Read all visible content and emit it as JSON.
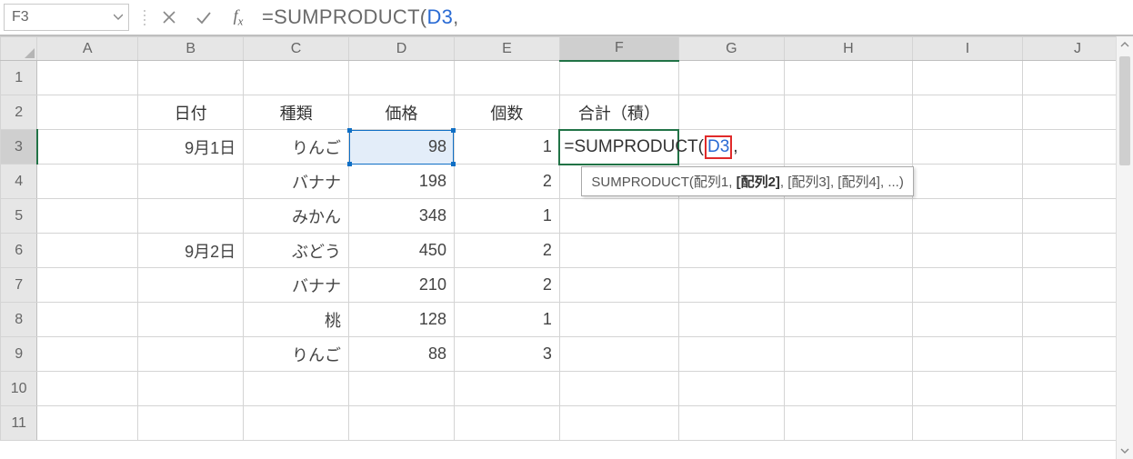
{
  "name_box": {
    "value": "F3"
  },
  "formula_bar": {
    "prefix": "=SUMPRODUCT(",
    "ref": "D3",
    "suffix": ","
  },
  "columns": [
    "A",
    "B",
    "C",
    "D",
    "E",
    "F",
    "G",
    "H",
    "I",
    "J"
  ],
  "rows": [
    "1",
    "2",
    "3",
    "4",
    "5",
    "6",
    "7",
    "8",
    "9",
    "10",
    "11"
  ],
  "table": {
    "headers": {
      "B": "日付",
      "C": "種類",
      "D": "価格",
      "E": "個数",
      "F": "合計（積）"
    },
    "rows": [
      {
        "B": "9月1日",
        "C": "りんご",
        "D": "98",
        "E": "1"
      },
      {
        "B": "",
        "C": "バナナ",
        "D": "198",
        "E": "2"
      },
      {
        "B": "",
        "C": "みかん",
        "D": "348",
        "E": "1"
      },
      {
        "B": "9月2日",
        "C": "ぶどう",
        "D": "450",
        "E": "2"
      },
      {
        "B": "",
        "C": "バナナ",
        "D": "210",
        "E": "2"
      },
      {
        "B": "",
        "C": "桃",
        "D": "128",
        "E": "1"
      },
      {
        "B": "",
        "C": "りんご",
        "D": "88",
        "E": "3"
      }
    ]
  },
  "cell_formula": {
    "prefix": "=SUMPRODUCT(",
    "ref": "D3",
    "suffix": ","
  },
  "tooltip": {
    "fn": "SUMPRODUCT",
    "arg1": "配列1",
    "arg2_bold": "[配列2]",
    "arg3": "[配列3]",
    "arg4": "[配列4]",
    "more": ", ...)"
  }
}
